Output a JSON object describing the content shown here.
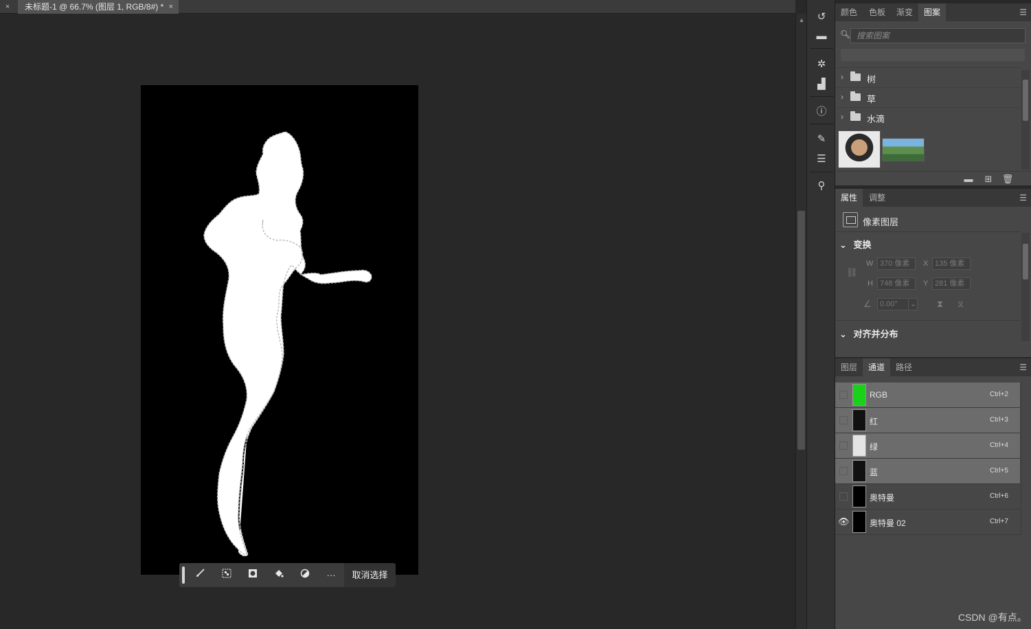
{
  "tabs": {
    "prev_close": "×",
    "document_title": "未标题-1 @ 66.7% (图层 1, RGB/8#) *",
    "close": "×"
  },
  "taskbar": {
    "icons": [
      "brush-select-icon",
      "checker-icon",
      "mask-icon",
      "fill-icon",
      "adjust-icon",
      "more-icon"
    ],
    "more": "···",
    "deselect": "取消选择"
  },
  "patterns_panel": {
    "tabs": [
      "颜色",
      "色板",
      "渐变",
      "图案"
    ],
    "active_tab": "图案",
    "search_placeholder": "搜索图案",
    "folders": [
      "树",
      "草",
      "水滴"
    ]
  },
  "properties_panel": {
    "tabs": [
      "属性",
      "调整"
    ],
    "layer_type": "像素图层",
    "transform_title": "变换",
    "w_label": "W",
    "w_value": "370 像素",
    "x_label": "X",
    "x_value": "135 像素",
    "h_label": "H",
    "h_value": "748 像素",
    "y_label": "Y",
    "y_value": "281 像素",
    "angle_value": "0.00°",
    "align_title": "对齐并分布"
  },
  "channels_panel": {
    "tabs": [
      "图层",
      "通道",
      "路径"
    ],
    "active_tab": "通道",
    "rows": [
      {
        "name": "RGB",
        "shortcut": "Ctrl+2",
        "visible": false,
        "selected": true
      },
      {
        "name": "红",
        "shortcut": "Ctrl+3",
        "visible": false,
        "selected": true
      },
      {
        "name": "绿",
        "shortcut": "Ctrl+4",
        "visible": false,
        "selected": true
      },
      {
        "name": "蓝",
        "shortcut": "Ctrl+5",
        "visible": false,
        "selected": true
      },
      {
        "name": "奥特曼",
        "shortcut": "Ctrl+6",
        "visible": false,
        "selected": false
      },
      {
        "name": "奥特曼 02",
        "shortcut": "Ctrl+7",
        "visible": true,
        "selected": false
      }
    ]
  },
  "colors": {
    "rgb_thumb": "#19d119",
    "selection": "#ffffff"
  },
  "watermark": "CSDN @有点。"
}
